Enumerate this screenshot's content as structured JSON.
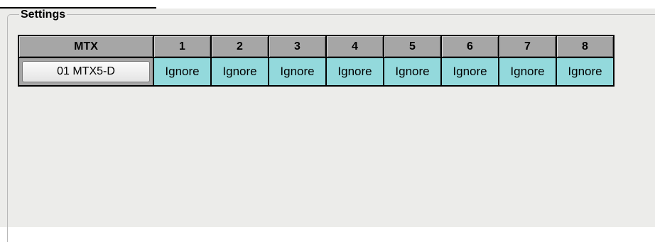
{
  "settings": {
    "title": "Settings",
    "table": {
      "header_label": "MTX",
      "columns": [
        "1",
        "2",
        "3",
        "4",
        "5",
        "6",
        "7",
        "8"
      ],
      "row": {
        "device_label": "01 MTX5-D",
        "values": [
          "Ignore",
          "Ignore",
          "Ignore",
          "Ignore",
          "Ignore",
          "Ignore",
          "Ignore",
          "Ignore"
        ]
      }
    }
  },
  "colors": {
    "header_bg": "#a6a6a6",
    "value_cell_bg": "#93d9dc",
    "panel_bg": "#ececea",
    "grid_border": "#000000"
  }
}
